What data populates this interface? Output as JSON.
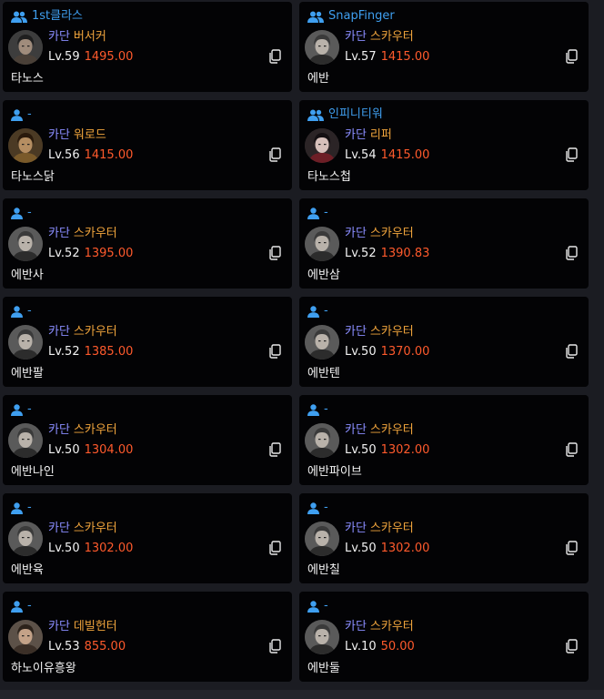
{
  "colors": {
    "page_bg": "#1b1c22",
    "card_bg": "#030305",
    "guild_blue": "#3f9ff0",
    "job_purple": "#8a8dff",
    "subclass_orange": "#f0a43c",
    "score_red": "#ff5a2c",
    "text_white": "#f3f3f3"
  },
  "characters": [
    {
      "guild": "1st클라스",
      "guild_icon": "group-icon",
      "job": "카단",
      "subclass": "버서커",
      "level": "Lv.59",
      "score": "1495.00",
      "name": "타노스",
      "avatar": "berserker-avatar-icon"
    },
    {
      "guild": "SnapFinger",
      "guild_icon": "group-icon",
      "job": "카단",
      "subclass": "스카우터",
      "level": "Lv.57",
      "score": "1415.00",
      "name": "에반",
      "avatar": "scouter-avatar-icon"
    },
    {
      "guild": "-",
      "guild_icon": "person-icon",
      "job": "카단",
      "subclass": "워로드",
      "level": "Lv.56",
      "score": "1415.00",
      "name": "타노스닭",
      "avatar": "warlord-avatar-icon"
    },
    {
      "guild": "인피니티워",
      "guild_icon": "group-icon",
      "job": "카단",
      "subclass": "리퍼",
      "level": "Lv.54",
      "score": "1415.00",
      "name": "타노스첩",
      "avatar": "reaper-avatar-icon"
    },
    {
      "guild": "-",
      "guild_icon": "person-icon",
      "job": "카단",
      "subclass": "스카우터",
      "level": "Lv.52",
      "score": "1395.00",
      "name": "에반사",
      "avatar": "scouter-avatar-icon"
    },
    {
      "guild": "-",
      "guild_icon": "person-icon",
      "job": "카단",
      "subclass": "스카우터",
      "level": "Lv.52",
      "score": "1390.83",
      "name": "에반삼",
      "avatar": "scouter-avatar-icon"
    },
    {
      "guild": "-",
      "guild_icon": "person-icon",
      "job": "카단",
      "subclass": "스카우터",
      "level": "Lv.52",
      "score": "1385.00",
      "name": "에반팔",
      "avatar": "scouter-avatar-icon"
    },
    {
      "guild": "-",
      "guild_icon": "person-icon",
      "job": "카단",
      "subclass": "스카우터",
      "level": "Lv.50",
      "score": "1370.00",
      "name": "에반텐",
      "avatar": "scouter-avatar-icon"
    },
    {
      "guild": "-",
      "guild_icon": "person-icon",
      "job": "카단",
      "subclass": "스카우터",
      "level": "Lv.50",
      "score": "1304.00",
      "name": "에반나인",
      "avatar": "scouter-avatar-icon"
    },
    {
      "guild": "-",
      "guild_icon": "person-icon",
      "job": "카단",
      "subclass": "스카우터",
      "level": "Lv.50",
      "score": "1302.00",
      "name": "에반파이브",
      "avatar": "scouter-avatar-icon"
    },
    {
      "guild": "-",
      "guild_icon": "person-icon",
      "job": "카단",
      "subclass": "스카우터",
      "level": "Lv.50",
      "score": "1302.00",
      "name": "에반육",
      "avatar": "scouter-avatar-icon"
    },
    {
      "guild": "-",
      "guild_icon": "person-icon",
      "job": "카단",
      "subclass": "스카우터",
      "level": "Lv.50",
      "score": "1302.00",
      "name": "에반칠",
      "avatar": "scouter-avatar-icon"
    },
    {
      "guild": "-",
      "guild_icon": "person-icon",
      "job": "카단",
      "subclass": "데빌헌터",
      "level": "Lv.53",
      "score": "855.00",
      "name": "하노이유흥왕",
      "avatar": "devilhunter-avatar-icon"
    },
    {
      "guild": "-",
      "guild_icon": "person-icon",
      "job": "카단",
      "subclass": "스카우터",
      "level": "Lv.10",
      "score": "50.00",
      "name": "에반둘",
      "avatar": "scouter-avatar-icon"
    }
  ],
  "copy_icon": "copy-icon"
}
